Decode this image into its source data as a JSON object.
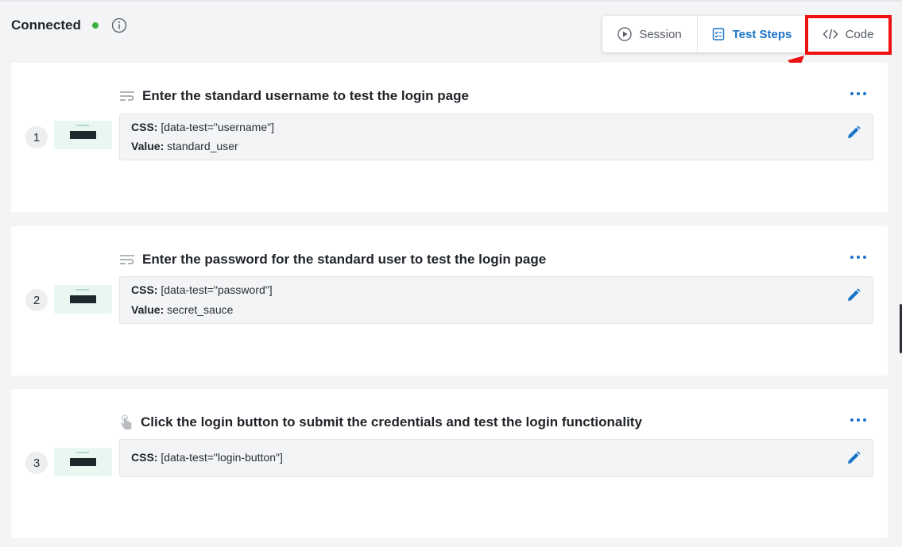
{
  "header": {
    "status_label": "Connected",
    "status_color": "#3cb043",
    "info_icon": "info-circle-icon"
  },
  "tabs": [
    {
      "label": "Session",
      "icon": "play-circle-icon",
      "active": false
    },
    {
      "label": "Test Steps",
      "icon": "checklist-icon",
      "active": true
    },
    {
      "label": "Code",
      "icon": "code-brackets-icon",
      "active": false
    }
  ],
  "annotation": {
    "highlight_color": "#ee1111",
    "target": "Code"
  },
  "steps": [
    {
      "number": "1",
      "action_icon": "type-text-icon",
      "title": "Enter the standard username to test the login page",
      "css_label": "CSS:",
      "css_value": "[data-test=\"username\"]",
      "value_label": "Value:",
      "value": "standard_user"
    },
    {
      "number": "2",
      "action_icon": "type-text-icon",
      "title": "Enter the password for the standard user to test the login page",
      "css_label": "CSS:",
      "css_value": "[data-test=\"password\"]",
      "value_label": "Value:",
      "value": "secret_sauce"
    },
    {
      "number": "3",
      "action_icon": "tap-hand-icon",
      "title": "Click the login button to submit the credentials and test the login functionality",
      "css_label": "CSS:",
      "css_value": "[data-test=\"login-button\"]"
    }
  ],
  "colors": {
    "accent": "#1a73c9",
    "background": "#f3f4f6",
    "card": "#ffffff",
    "thumbnail_bg": "#e8f7f1"
  }
}
